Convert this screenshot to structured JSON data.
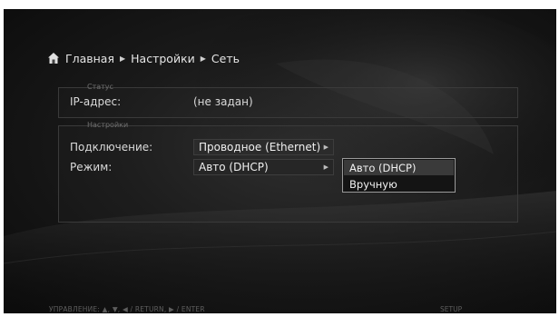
{
  "breadcrumb": {
    "home": "Главная",
    "settings": "Настройки",
    "network": "Сеть"
  },
  "status_group": {
    "title": "Статус",
    "ip_label": "IP-адрес:",
    "ip_value": "(не задан)"
  },
  "settings_group": {
    "title": "Настройки",
    "connection_label": "Подключение:",
    "connection_value": "Проводное (Ethernet)",
    "mode_label": "Режим:",
    "mode_value": "Авто (DHCP)"
  },
  "mode_dropdown": {
    "options": [
      "Авто (DHCP)",
      "Вручную"
    ],
    "selected": "Авто (DHCP)"
  },
  "footer": {
    "controls": "УПРАВЛЕНИЕ:  ▲, ▼,  ◀ / RETURN,  ▶ / ENTER",
    "setup": "SETUP"
  },
  "icons": {
    "home": "home-icon",
    "separator": "chevron-right-icon",
    "field_arrow": "chevron-right-icon"
  },
  "colors": {
    "background": "#1a1a1a",
    "text": "#dadada",
    "highlight": "#3a3a3a"
  }
}
